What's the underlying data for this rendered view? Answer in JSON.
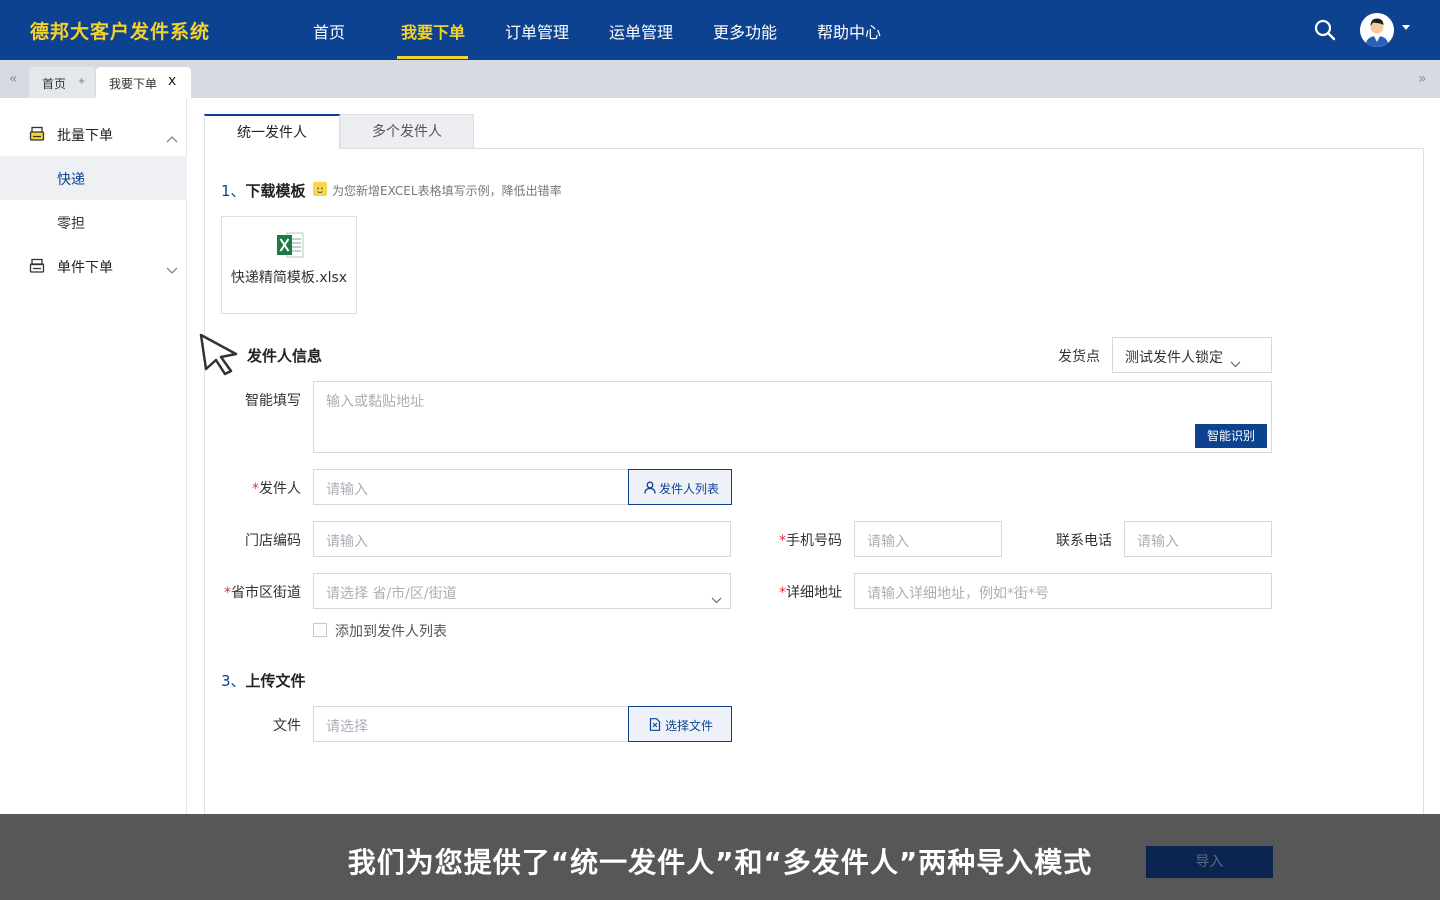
{
  "app": {
    "brand": "德邦大客户发件系统"
  },
  "nav": {
    "items": [
      "首页",
      "我要下单",
      "订单管理",
      "运单管理",
      "更多功能",
      "帮助中心"
    ],
    "active_index": 1
  },
  "tabs": {
    "home": "首页",
    "current": "我要下单",
    "close_glyph": "x"
  },
  "sidebar": {
    "batch": "批量下单",
    "batch_items": [
      "快递",
      "零担"
    ],
    "single": "单件下单"
  },
  "mode_tabs": {
    "unified": "统一发件人",
    "multi": "多个发件人"
  },
  "download": {
    "num": "1、",
    "title": "下载模板",
    "hint": "为您新增EXCEL表格填写示例，降低出错率",
    "file_name": "快递精简模板.xlsx"
  },
  "sender": {
    "title": "发件人信息",
    "dispatch_label": "发货点",
    "dispatch_value": "测试发件人锁定",
    "smart_label": "智能填写",
    "smart_placeholder": "输入或黏贴地址",
    "smart_button": "智能识别",
    "required_mark": "*",
    "name_label": "发件人",
    "name_placeholder": "请输入",
    "name_list_button": "发件人列表",
    "store_label": "门店编码",
    "store_placeholder": "请输入",
    "mobile_label": "手机号码",
    "mobile_placeholder": "请输入",
    "phone_label": "联系电话",
    "phone_placeholder": "请输入",
    "region_label": "省市区街道",
    "region_placeholder": "请选择 省/市/区/街道",
    "address_label": "详细地址",
    "address_placeholder": "请输入详细地址，例如*街*号",
    "add_to_list": "添加到发件人列表"
  },
  "upload": {
    "num": "3、",
    "title": "上传文件",
    "file_label": "文件",
    "file_placeholder": "请选择",
    "choose_button": "选择文件"
  },
  "caption": {
    "text": "我们为您提供了“统一发件人”和“多发件人”两种导入模式",
    "import_button": "导入"
  },
  "colors": {
    "primary": "#0d4290",
    "accent": "#f5d22a",
    "required": "#e0323c"
  }
}
